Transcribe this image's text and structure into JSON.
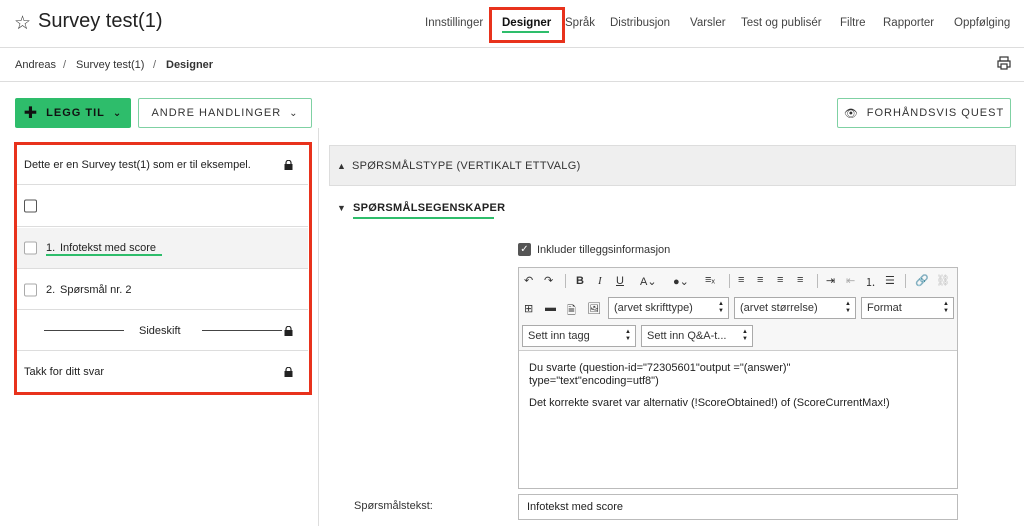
{
  "header": {
    "title": "Survey test(1)",
    "nav": [
      "Innstillinger",
      "Designer",
      "Språk",
      "Distribusjon",
      "Varsler",
      "Test og publisér",
      "Filtre",
      "Rapporter",
      "Oppfølging"
    ],
    "active_tab": "Designer"
  },
  "breadcrumb": [
    "Andreas",
    "/",
    "Survey test(1)",
    "/",
    "Designer"
  ],
  "toolbar": {
    "add_label": "LEGG TIL",
    "other_label": "ANDRE HANDLINGER",
    "preview_label": "FORHÅNDSVIS QUEST"
  },
  "left_panel": {
    "intro_text": "Dette er en Survey test(1) som er til eksempel.",
    "q1_number": "1.",
    "q1_text": "Infotekst med score",
    "q2_number": "2.",
    "q2_text": "Spørsmål nr. 2",
    "page_break": "Sideskift",
    "thanks_text": "Takk for ditt svar"
  },
  "right_panel": {
    "question_type": "SPØRSMÅLSTYPE (VERTIKALT ETTVALG)",
    "properties_title": "SPØRSMÅLSEGENSKAPER",
    "include_extra_info": "Inkluder tilleggsinformasjon",
    "include_checked": true,
    "editor": {
      "font_select": "(arvet skrifttype)",
      "size_select": "(arvet størrelse)",
      "format_select": "Format",
      "insert_tag": "Sett inn tagg",
      "insert_qa": "Sett inn Q&A-t...",
      "line1": "Du svarte (question-id=\"72305601\"output =\"(answer)\"",
      "line2": "type=\"text\"encoding=utf8\")",
      "line3": "Det korrekte svaret var alternativ (!ScoreObtained!) of (ScoreCurrentMax!)"
    },
    "question_text_label": "Spørsmålstekst:",
    "question_text_value": "Infotekst med score"
  },
  "colors": {
    "accent_green": "#2ebd6b",
    "highlight_red": "#e8321c"
  }
}
